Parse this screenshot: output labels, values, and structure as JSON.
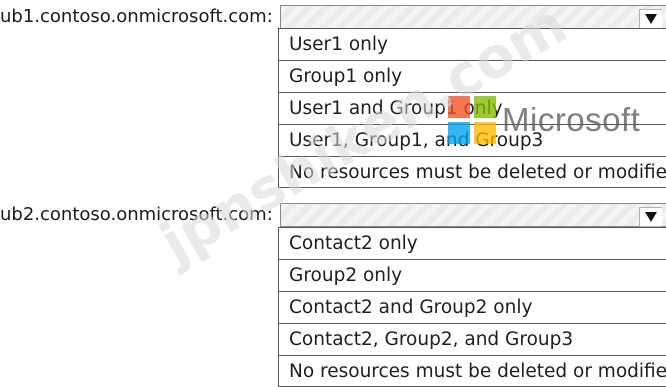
{
  "question1": {
    "label": "ub1.contoso.onmicrosoft.com:",
    "selected_value": "",
    "options": [
      "User1 only",
      "Group1 only",
      "User1 and Group1 only",
      "User1, Group1, and Group3",
      "No resources must be deleted or modified"
    ]
  },
  "question2": {
    "label": "ub2.contoso.onmicrosoft.com:",
    "selected_value": "",
    "options": [
      "Contact2 only",
      "Group2 only",
      "Contact2 and Group2 only",
      "Contact2, Group2, and Group3",
      "No resources must be deleted or modified"
    ]
  },
  "watermark": {
    "logo_text": "Microsoft",
    "logo_colors": [
      "#f25022",
      "#7fba00",
      "#00a4ef",
      "#ffb900"
    ],
    "site_text": "jpnshiken.com"
  }
}
